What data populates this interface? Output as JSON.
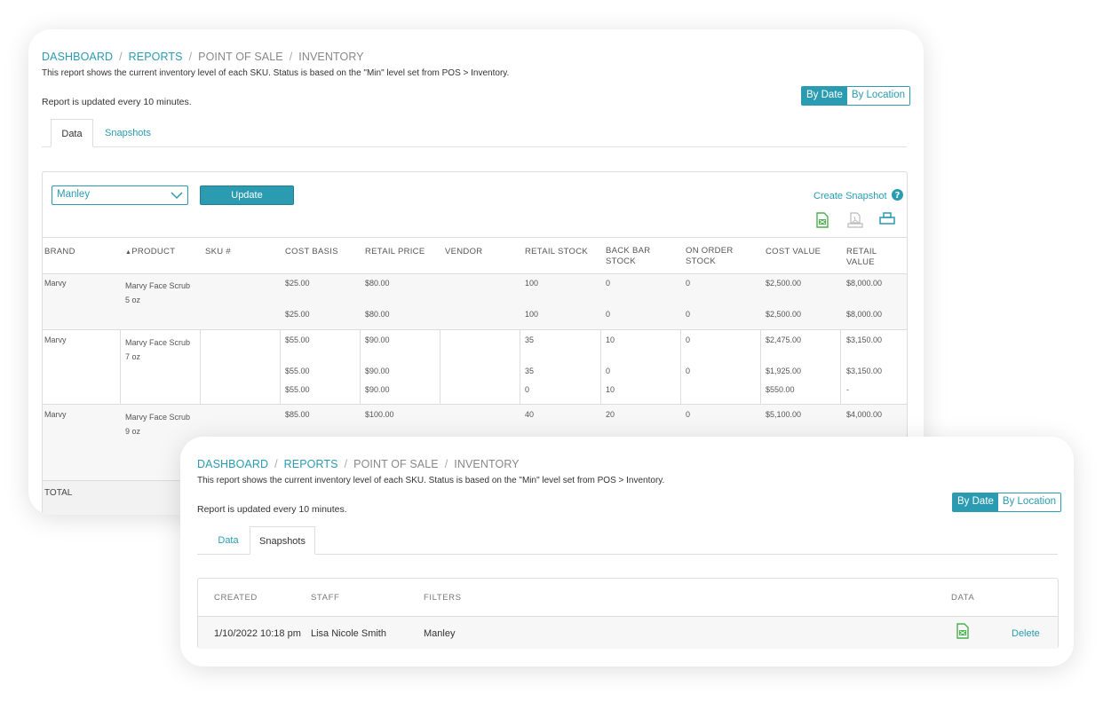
{
  "colors": {
    "accent": "#2a9bb0",
    "excel_green": "#4caf50",
    "border": "#dddddd"
  },
  "breadcrumb": [
    "DASHBOARD",
    "REPORTS",
    "POINT OF SALE",
    "INVENTORY"
  ],
  "description": "This report shows the current inventory level of each SKU. Status is based on the \"Min\" level set from POS > Inventory.",
  "update_note": "Report is updated every 10 minutes.",
  "toggle": {
    "by_date": "By Date",
    "by_location": "By Location"
  },
  "tabs": {
    "data": "Data",
    "snapshots": "Snapshots"
  },
  "filter": {
    "selected": "Manley",
    "update_label": "Update",
    "create_snapshot": "Create Snapshot"
  },
  "icons": {
    "excel": "excel-icon",
    "pdf": "pdf-icon",
    "print": "print-icon",
    "help": "help-icon",
    "chevron": "chevron-down-icon"
  },
  "table": {
    "headers": [
      "BRAND",
      "PRODUCT",
      "SKU #",
      "COST BASIS",
      "RETAIL PRICE",
      "VENDOR",
      "RETAIL STOCK",
      "BACK BAR",
      "STOCK",
      "ON ORDER",
      "STOCK",
      "COST VALUE",
      "RETAIL VALUE"
    ],
    "sort_arrow": "▲",
    "groups": [
      {
        "brand": "Marvy",
        "product": [
          "Marvy Face Scrub",
          "5 oz"
        ],
        "rows": [
          [
            "$25.00",
            "$80.00",
            "100",
            "0",
            "0",
            "$2,500.00",
            "$8,000.00"
          ],
          [
            "$25.00",
            "$80.00",
            "100",
            "0",
            "0",
            "$2,500.00",
            "$8,000.00"
          ]
        ]
      },
      {
        "brand": "Marvy",
        "product": [
          "Marvy Face Scrub",
          "7 oz"
        ],
        "rows": [
          [
            "$55.00",
            "$90.00",
            "35",
            "10",
            "0",
            "$2,475.00",
            "$3,150.00"
          ],
          [
            "$55.00",
            "$90.00",
            "35",
            "0",
            "0",
            "$1,925.00",
            "$3,150.00"
          ],
          [
            "$55.00",
            "$90.00",
            "0",
            "10",
            "",
            "$550.00",
            "-"
          ]
        ]
      },
      {
        "brand": "Marvy",
        "product": [
          "Marvy Face Scrub",
          "9 oz"
        ],
        "rows": [
          [
            "$85.00",
            "$100.00",
            "40",
            "20",
            "0",
            "$5,100.00",
            "$4,000.00"
          ]
        ]
      }
    ],
    "total_label": "TOTAL"
  },
  "snapshots": {
    "headers": [
      "CREATED",
      "STAFF",
      "FILTERS",
      "DATA"
    ],
    "rows": [
      {
        "created": "1/10/2022 10:18 pm",
        "staff": "Lisa Nicole Smith",
        "filters": "Manley",
        "delete": "Delete"
      }
    ]
  }
}
